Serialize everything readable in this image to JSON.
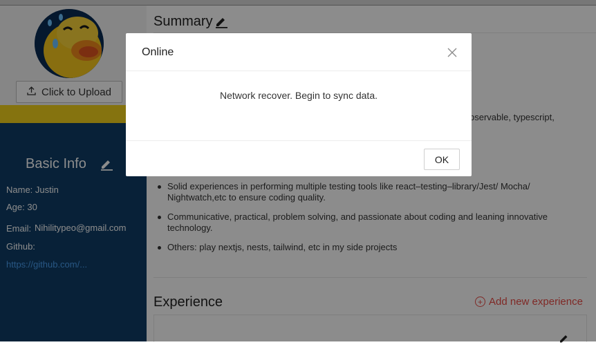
{
  "sidebar": {
    "upload_label": "Click to Upload",
    "basic_info_title": "Basic Info",
    "name_line": "Name: Justin",
    "age_line": "Age: 30",
    "email_label": "Email:",
    "email_value": "Nihilitypeo@gmail.com",
    "github_label": "Github:",
    "github_value": "https://github.com/..."
  },
  "main": {
    "summary_title": "Summary",
    "summary_fragment": "bservable, typescript,",
    "bullets": [
      "Solid experiences in performing multiple testing tools like react–testing–library/Jest/ Mocha/ Nightwatch,etc to ensure coding quality.",
      "Communicative, practical, problem solving, and passionate about coding and leaning innovative technology.",
      "Others: play nextjs, nests, tailwind, etc in my side projects"
    ],
    "experience_title": "Experience",
    "add_experience_label": "Add new experience"
  },
  "modal": {
    "title": "Online",
    "message": "Network recover. Begin to sync data.",
    "ok_label": "OK",
    "close_glyph": "X"
  },
  "colors": {
    "navy": "#0f3d66",
    "yellow": "#f2d21c",
    "link": "#4a9ef0",
    "accent_red": "#e84b45"
  }
}
